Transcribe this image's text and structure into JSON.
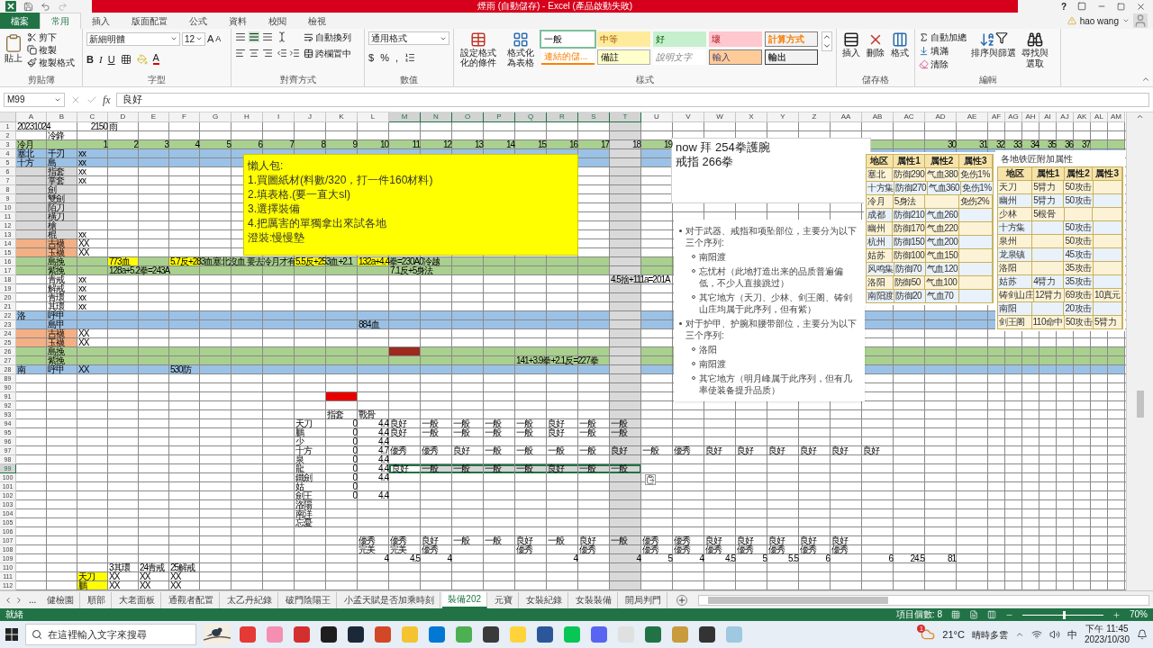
{
  "title_bar": {
    "title": "煙雨 (自動儲存) - Excel (產品啟動失敗)",
    "help": "?"
  },
  "ribbon_tabs": [
    {
      "label": "檔案",
      "kind": "file",
      "selected": false
    },
    {
      "label": "常用",
      "kind": "tab",
      "selected": true
    },
    {
      "label": "插入",
      "kind": "tab",
      "selected": false
    },
    {
      "label": "版面配置",
      "kind": "tab",
      "selected": false
    },
    {
      "label": "公式",
      "kind": "tab",
      "selected": false
    },
    {
      "label": "資料",
      "kind": "tab",
      "selected": false
    },
    {
      "label": "校閱",
      "kind": "tab",
      "selected": false
    },
    {
      "label": "檢視",
      "kind": "tab",
      "selected": false
    }
  ],
  "account": {
    "name": "hao wang"
  },
  "ribbon": {
    "clipboard": {
      "paste": "貼上",
      "cut": "剪下",
      "copy": "複製",
      "format_painter": "複製格式",
      "group": "剪貼簿"
    },
    "font": {
      "face": "新細明體",
      "size": "12",
      "grow": "A",
      "shrink": "A",
      "bold": "B",
      "italic": "I",
      "underline": "U",
      "color_letter": "A",
      "group": "字型"
    },
    "alignment": {
      "wrap": "自動換列",
      "merge": "跨欄置中",
      "group": "對齊方式"
    },
    "number": {
      "format": "通用格式",
      "currency": "$",
      "percent": "%",
      "comma": ",",
      "group": "數值"
    },
    "styles": {
      "conditional": "設定格式化的條件",
      "as_table": "格式化為表格",
      "group": "樣式",
      "gallery": [
        {
          "label": "一般",
          "kind": "normal",
          "selected": true
        },
        {
          "label": "中等",
          "kind": "neutral",
          "selected": false
        },
        {
          "label": "好",
          "kind": "good",
          "selected": false
        },
        {
          "label": "壞",
          "kind": "bad",
          "selected": false
        },
        {
          "label": "計算方式",
          "kind": "calculation",
          "selected": false
        },
        {
          "label": "連結的儲...",
          "kind": "linked",
          "selected": false
        },
        {
          "label": "備註",
          "kind": "note",
          "selected": false
        },
        {
          "label": "說明文字",
          "kind": "explanatory",
          "selected": false
        },
        {
          "label": "輸入",
          "kind": "input",
          "selected": false
        },
        {
          "label": "輸出",
          "kind": "output",
          "selected": false
        }
      ]
    },
    "cells": {
      "items": [
        {
          "label": "插入",
          "kind": "insert"
        },
        {
          "label": "刪除",
          "kind": "delete"
        },
        {
          "label": "格式",
          "kind": "format"
        }
      ],
      "group": "儲存格"
    },
    "editing": {
      "items": [
        {
          "label": "自動加總",
          "kind": "sum"
        },
        {
          "label": "填滿",
          "kind": "fill"
        },
        {
          "label": "清除",
          "kind": "clear"
        }
      ],
      "sort": "排序與篩選",
      "find": "尋找與選取",
      "group": "編輯"
    }
  },
  "formula_bar": {
    "name_box": "M99",
    "function_label": "fx",
    "value": "良好"
  },
  "columns": [
    {
      "label": "A",
      "selected": false
    },
    {
      "label": "B",
      "selected": false
    },
    {
      "label": "C",
      "selected": false
    },
    {
      "label": "D",
      "selected": false
    },
    {
      "label": "E",
      "selected": false
    },
    {
      "label": "F",
      "selected": false
    },
    {
      "label": "G",
      "selected": false
    },
    {
      "label": "H",
      "selected": false
    },
    {
      "label": "I",
      "selected": false
    },
    {
      "label": "J",
      "selected": false
    },
    {
      "label": "K",
      "selected": false
    },
    {
      "label": "L",
      "selected": false
    },
    {
      "label": "M",
      "selected": true
    },
    {
      "label": "N",
      "selected": true
    },
    {
      "label": "O",
      "selected": true
    },
    {
      "label": "P",
      "selected": true
    },
    {
      "label": "Q",
      "selected": true
    },
    {
      "label": "R",
      "selected": true
    },
    {
      "label": "S",
      "selected": true
    },
    {
      "label": "T",
      "selected": true,
      "shaded": true
    },
    {
      "label": "U",
      "selected": false
    },
    {
      "label": "V",
      "selected": false
    },
    {
      "label": "W",
      "selected": false
    },
    {
      "label": "X",
      "selected": false
    },
    {
      "label": "Y",
      "selected": false
    },
    {
      "label": "Z",
      "selected": false
    },
    {
      "label": "AA",
      "selected": false
    },
    {
      "label": "AB",
      "selected": false
    },
    {
      "label": "AC",
      "selected": false
    },
    {
      "label": "AD",
      "selected": false
    },
    {
      "label": "AE",
      "selected": false
    },
    {
      "label": "AF",
      "selected": false
    },
    {
      "label": "AG",
      "selected": false
    },
    {
      "label": "AH",
      "selected": false
    },
    {
      "label": "AI",
      "selected": false
    },
    {
      "label": "AJ",
      "selected": false
    },
    {
      "label": "AK",
      "selected": false
    },
    {
      "label": "AL",
      "selected": false
    },
    {
      "label": "AM",
      "selected": false
    }
  ],
  "rows": [
    {
      "number": "1",
      "selected": false,
      "cells": [
        {
          "text": "20231024"
        },
        {},
        {
          "text": "2150",
          "kind": "number"
        },
        {
          "text": "雨"
        }
      ]
    },
    {
      "number": "2",
      "selected": false,
      "cells": [
        {},
        {
          "text": "冷鋒"
        }
      ]
    },
    {
      "number": "3",
      "selected": false,
      "color": "#a9d08e",
      "cells": [
        {
          "text": "冷月"
        },
        {},
        {
          "text": "1",
          "kind": "number"
        },
        {
          "text": "2",
          "kind": "number"
        },
        {
          "text": "3",
          "kind": "number"
        },
        {
          "text": "4",
          "kind": "number"
        },
        {
          "text": "5",
          "kind": "number"
        },
        {
          "text": "6",
          "kind": "number"
        },
        {
          "text": "7",
          "kind": "number"
        },
        {
          "text": "8",
          "kind": "number"
        },
        {
          "text": "9",
          "kind": "number"
        },
        {
          "text": "10",
          "kind": "number"
        },
        {
          "text": "11",
          "kind": "number"
        },
        {
          "text": "12",
          "kind": "number"
        },
        {
          "text": "13",
          "kind": "number"
        },
        {
          "text": "14",
          "kind": "number"
        },
        {
          "text": "15",
          "kind": "number"
        },
        {
          "text": "16",
          "kind": "number"
        },
        {
          "text": "17",
          "kind": "number"
        },
        {
          "text": "18",
          "kind": "number"
        },
        {
          "text": "19",
          "kind": "number"
        },
        {},
        {},
        {},
        {},
        {},
        {},
        {},
        {},
        {
          "text": "30",
          "kind": "number"
        },
        {
          "text": "31",
          "kind": "number"
        },
        {
          "text": "32",
          "kind": "number"
        },
        {
          "text": "33",
          "kind": "number"
        },
        {
          "text": "34",
          "kind": "number"
        },
        {
          "text": "35",
          "kind": "number"
        },
        {
          "text": "36",
          "kind": "number"
        },
        {
          "text": "37",
          "kind": "number"
        }
      ]
    },
    {
      "number": "4",
      "selected": false,
      "color": "#9bc2e6",
      "cells": [
        {
          "text": "塞北"
        },
        {
          "text": "千刃"
        },
        {
          "text": "xx"
        }
      ]
    },
    {
      "number": "5",
      "selected": false,
      "color": "#9bc2e6",
      "cells": [
        {
          "text": "十方"
        },
        {
          "text": "島"
        },
        {
          "text": "xx"
        }
      ]
    },
    {
      "number": "6",
      "selected": false,
      "cells": [
        {
          "color": "#d9d9d9"
        },
        {
          "text": "指套",
          "color": "#d9d9d9"
        },
        {
          "text": "xx"
        }
      ]
    },
    {
      "number": "7",
      "selected": false,
      "cells": [
        {
          "color": "#d9d9d9"
        },
        {
          "text": "掌套",
          "color": "#d9d9d9"
        },
        {
          "text": "xx"
        }
      ]
    },
    {
      "number": "8",
      "selected": false,
      "cells": [
        {
          "color": "#d9d9d9"
        },
        {
          "text": "劍",
          "color": "#d9d9d9"
        }
      ]
    },
    {
      "number": "9",
      "selected": false,
      "cells": [
        {
          "color": "#d9d9d9"
        },
        {
          "text": "雙劍",
          "color": "#d9d9d9"
        }
      ]
    },
    {
      "number": "10",
      "selected": false,
      "cells": [
        {
          "color": "#d9d9d9"
        },
        {
          "text": "陌刀",
          "color": "#d9d9d9"
        }
      ]
    },
    {
      "number": "11",
      "selected": false,
      "cells": [
        {
          "color": "#d9d9d9"
        },
        {
          "text": "橫刀",
          "color": "#d9d9d9"
        }
      ]
    },
    {
      "number": "12",
      "selected": false,
      "cells": [
        {
          "color": "#d9d9d9"
        },
        {
          "text": "槍",
          "color": "#d9d9d9"
        }
      ]
    },
    {
      "number": "13",
      "selected": false,
      "cells": [
        {
          "color": "#d9d9d9"
        },
        {
          "text": "棍",
          "color": "#d9d9d9"
        },
        {
          "text": "xx"
        }
      ]
    },
    {
      "number": "14",
      "selected": false,
      "cells": [
        {
          "color": "#f4b084"
        },
        {
          "text": "吉襪",
          "color": "#f4b084"
        },
        {
          "text": "XX"
        }
      ]
    },
    {
      "number": "15",
      "selected": false,
      "cells": [
        {
          "color": "#f4b084"
        },
        {
          "text": "玉襪",
          "color": "#f4b084"
        },
        {
          "text": "XX"
        }
      ]
    },
    {
      "number": "16",
      "selected": false,
      "color": "#a9d08e",
      "cells": [
        {},
        {
          "text": "島挽"
        },
        {},
        {
          "text": "773血",
          "color": "#ffff00"
        },
        {},
        {
          "text": "5.7反+283血塞北沒血 要去冷月才有",
          "color": "#ffff00"
        },
        {},
        {},
        {},
        {
          "text": "5.5反+253血+2.1",
          "color": "#ffff00"
        },
        {},
        {
          "text": "132a+4.4拳=230A0冷越",
          "color": "#ffff00"
        }
      ]
    },
    {
      "number": "17",
      "selected": false,
      "color": "#a9d08e",
      "cells": [
        {},
        {
          "text": "紫挽"
        },
        {},
        {
          "text": "128a+5.2拳=243A"
        },
        {},
        {},
        {},
        {},
        {},
        {},
        {},
        {},
        {
          "text": "7.1反+5身法"
        }
      ]
    },
    {
      "number": "18",
      "selected": false,
      "cells": [
        {},
        {
          "text": "青戒"
        },
        {
          "text": "xx"
        },
        {},
        {},
        {},
        {},
        {},
        {},
        {},
        {},
        {},
        {},
        {},
        {},
        {},
        {},
        {},
        {},
        {
          "text": "4.5捨+111a=201A"
        }
      ]
    },
    {
      "number": "19",
      "selected": false,
      "cells": [
        {},
        {
          "text": "解戒"
        },
        {
          "text": "xx"
        }
      ]
    },
    {
      "number": "20",
      "selected": false,
      "cells": [
        {},
        {
          "text": "青環"
        },
        {
          "text": "xx"
        }
      ]
    },
    {
      "number": "21",
      "selected": false,
      "cells": [
        {},
        {
          "text": "其環"
        },
        {
          "text": "xx"
        }
      ]
    },
    {
      "number": "22",
      "selected": false,
      "color": "#9bc2e6",
      "cells": [
        {
          "text": "洛"
        },
        {
          "text": "呼甲"
        }
      ]
    },
    {
      "number": "23",
      "selected": false,
      "color": "#9bc2e6",
      "cells": [
        {},
        {
          "text": "島甲"
        },
        {},
        {},
        {},
        {},
        {},
        {},
        {},
        {},
        {},
        {
          "text": "884血"
        }
      ]
    },
    {
      "number": "24",
      "selected": false,
      "cells": [
        {
          "color": "#f4b084"
        },
        {
          "text": "吉襪",
          "color": "#f4b084"
        },
        {
          "text": "XX"
        }
      ]
    },
    {
      "number": "25",
      "selected": false,
      "cells": [
        {
          "color": "#f4b084"
        },
        {
          "text": "玉襪",
          "color": "#f4b084"
        },
        {
          "text": "XX"
        }
      ]
    },
    {
      "number": "26",
      "selected": false,
      "color": "#a9d08e",
      "cells": [
        {},
        {
          "text": "島挽"
        },
        {},
        {},
        {},
        {},
        {},
        {},
        {},
        {},
        {},
        {},
        {
          "color": "#9c2a1f"
        }
      ]
    },
    {
      "number": "27",
      "selected": false,
      "color": "#a9d08e",
      "cells": [
        {},
        {
          "text": "紫挽"
        },
        {},
        {},
        {},
        {},
        {},
        {},
        {},
        {},
        {},
        {},
        {},
        {},
        {},
        {},
        {
          "text": "141+3.9拳+2.1反=227拳"
        }
      ]
    },
    {
      "number": "28",
      "selected": false,
      "color": "#9bc2e6",
      "cells": [
        {
          "text": "南"
        },
        {
          "text": "呼甲"
        },
        {
          "text": "XX"
        },
        {},
        {},
        {
          "text": "530防"
        }
      ]
    },
    {
      "number": "89",
      "selected": false
    },
    {
      "number": "90",
      "selected": false
    },
    {
      "number": "91",
      "selected": false,
      "cells": [
        {},
        {},
        {},
        {},
        {},
        {},
        {},
        {},
        {},
        {},
        {
          "color": "#e60000"
        }
      ]
    },
    {
      "number": "92",
      "selected": false
    },
    {
      "number": "93",
      "selected": false,
      "cells": [
        {},
        {},
        {},
        {},
        {},
        {},
        {},
        {},
        {},
        {},
        {
          "text": "指套"
        },
        {
          "text": "戰骨"
        }
      ]
    },
    {
      "number": "94",
      "selected": false,
      "cells": [
        {},
        {},
        {},
        {},
        {},
        {},
        {},
        {},
        {},
        {
          "text": "天刀"
        },
        {
          "text": "0",
          "kind": "number"
        },
        {
          "text": "4.4",
          "kind": "number"
        },
        {
          "text": "良好"
        },
        {
          "text": "一般"
        },
        {
          "text": "一般"
        },
        {
          "text": "一般"
        },
        {
          "text": "一般"
        },
        {
          "text": "良好"
        },
        {
          "text": "一般"
        },
        {
          "text": "一般"
        }
      ]
    },
    {
      "number": "95",
      "selected": false,
      "cells": [
        {},
        {},
        {},
        {},
        {},
        {},
        {},
        {},
        {},
        {
          "text": "鵬"
        },
        {
          "text": "0",
          "kind": "number"
        },
        {
          "text": "4.4",
          "kind": "number"
        },
        {
          "text": "良好"
        },
        {
          "text": "一般"
        },
        {
          "text": "一般"
        },
        {
          "text": "一般"
        },
        {
          "text": "一般"
        },
        {
          "text": "良好"
        },
        {
          "text": "一般"
        },
        {
          "text": "一般"
        }
      ]
    },
    {
      "number": "96",
      "selected": false,
      "cells": [
        {},
        {},
        {},
        {},
        {},
        {},
        {},
        {},
        {},
        {
          "text": "少"
        },
        {
          "text": "0",
          "kind": "number"
        },
        {
          "text": "4.4",
          "kind": "number"
        }
      ]
    },
    {
      "number": "97",
      "selected": false,
      "cells": [
        {},
        {},
        {},
        {},
        {},
        {},
        {},
        {},
        {},
        {
          "text": "十方"
        },
        {
          "text": "0",
          "kind": "number"
        },
        {
          "text": "4.7",
          "kind": "number"
        },
        {
          "text": "優秀"
        },
        {
          "text": "優秀"
        },
        {
          "text": "良好"
        },
        {
          "text": "一般"
        },
        {
          "text": "一般"
        },
        {
          "text": "一般"
        },
        {
          "text": "一般"
        },
        {
          "text": "良好"
        },
        {
          "text": "一般"
        },
        {
          "text": "優秀"
        },
        {
          "text": "良好"
        },
        {
          "text": "良好"
        },
        {
          "text": "良好"
        },
        {
          "text": "良好"
        },
        {
          "text": "良好"
        },
        {
          "text": "良好"
        }
      ]
    },
    {
      "number": "98",
      "selected": false,
      "cells": [
        {},
        {},
        {},
        {},
        {},
        {},
        {},
        {},
        {},
        {
          "text": "泉"
        },
        {
          "text": "0",
          "kind": "number"
        },
        {
          "text": "4.4",
          "kind": "number"
        }
      ]
    },
    {
      "number": "99",
      "selected": true,
      "cells": [
        {},
        {},
        {},
        {},
        {},
        {},
        {},
        {},
        {},
        {
          "text": "龍",
          "selected": false
        },
        {
          "text": "0",
          "kind": "number",
          "selected": false
        },
        {
          "text": "4.4",
          "kind": "number",
          "selected": false
        },
        {
          "text": "良好",
          "selected": true
        },
        {
          "text": "一般",
          "selected": true
        },
        {
          "text": "一般",
          "selected": true
        },
        {
          "text": "一般",
          "selected": true
        },
        {
          "text": "一般",
          "selected": true
        },
        {
          "text": "良好",
          "selected": true
        },
        {
          "text": "一般",
          "selected": true
        },
        {
          "text": "一般",
          "selected": true
        }
      ]
    },
    {
      "number": "100",
      "selected": false,
      "cells": [
        {},
        {},
        {},
        {},
        {},
        {},
        {},
        {},
        {},
        {
          "text": "鐵劍"
        },
        {
          "text": "0",
          "kind": "number"
        },
        {
          "text": "4.4",
          "kind": "number"
        }
      ]
    },
    {
      "number": "101",
      "selected": false,
      "cells": [
        {},
        {},
        {},
        {},
        {},
        {},
        {},
        {},
        {},
        {
          "text": "姑"
        },
        {
          "text": "0",
          "kind": "number"
        }
      ]
    },
    {
      "number": "102",
      "selected": false,
      "cells": [
        {},
        {},
        {},
        {},
        {},
        {},
        {},
        {},
        {},
        {
          "text": "劍王"
        },
        {
          "text": "0",
          "kind": "number"
        },
        {
          "text": "4.4",
          "kind": "number"
        }
      ]
    },
    {
      "number": "103",
      "selected": false,
      "cells": [
        {},
        {},
        {},
        {},
        {},
        {},
        {},
        {},
        {},
        {
          "text": "洛陽"
        }
      ]
    },
    {
      "number": "104",
      "selected": false,
      "cells": [
        {},
        {},
        {},
        {},
        {},
        {},
        {},
        {},
        {},
        {
          "text": "南洋"
        }
      ]
    },
    {
      "number": "105",
      "selected": false,
      "cells": [
        {},
        {},
        {},
        {},
        {},
        {},
        {},
        {},
        {},
        {
          "text": "忘憂"
        }
      ]
    },
    {
      "number": "106",
      "selected": false
    },
    {
      "number": "107",
      "selected": false,
      "cells": [
        {},
        {},
        {},
        {},
        {},
        {},
        {},
        {},
        {},
        {},
        {},
        {
          "text": "優秀"
        },
        {
          "text": "優秀"
        },
        {
          "text": "良好"
        },
        {
          "text": "一般"
        },
        {
          "text": "一般"
        },
        {
          "text": "良好"
        },
        {
          "text": "一般"
        },
        {
          "text": "良好"
        },
        {
          "text": "一般"
        },
        {
          "text": "優秀"
        },
        {
          "text": "優秀"
        },
        {
          "text": "良好"
        },
        {
          "text": "良好"
        },
        {
          "text": "良好"
        },
        {
          "text": "良好"
        },
        {
          "text": "良好"
        }
      ]
    },
    {
      "number": "108",
      "selected": false,
      "cells": [
        {},
        {},
        {},
        {},
        {},
        {},
        {},
        {},
        {},
        {},
        {},
        {
          "text": "完美"
        },
        {
          "text": "完美"
        },
        {
          "text": "優秀"
        },
        {},
        {},
        {
          "text": "優秀"
        },
        {},
        {
          "text": "優秀"
        },
        {},
        {
          "text": "優秀"
        },
        {
          "text": "優秀"
        },
        {
          "text": "優秀"
        },
        {
          "text": "優秀"
        },
        {
          "text": "優秀"
        },
        {
          "text": "優秀"
        },
        {
          "text": "優秀"
        }
      ]
    },
    {
      "number": "109",
      "selected": false,
      "cells": [
        {},
        {},
        {},
        {},
        {},
        {},
        {},
        {},
        {},
        {},
        {},
        {
          "text": "4",
          "kind": "number"
        },
        {
          "text": "4.5",
          "kind": "number"
        },
        {
          "text": "4",
          "kind": "number"
        },
        {},
        {},
        {},
        {
          "text": "4",
          "kind": "number"
        },
        {},
        {
          "text": "4",
          "kind": "number"
        },
        {
          "text": "5",
          "kind": "number"
        },
        {
          "text": "4",
          "kind": "number"
        },
        {
          "text": "4.5",
          "kind": "number"
        },
        {
          "text": "5",
          "kind": "number"
        },
        {
          "text": "5.5",
          "kind": "number"
        },
        {
          "text": "6",
          "kind": "number"
        },
        {},
        {
          "text": "6",
          "kind": "number"
        },
        {
          "text": "24.5",
          "kind": "number"
        },
        {
          "text": "81",
          "kind": "number"
        }
      ]
    },
    {
      "number": "110",
      "selected": false,
      "cells": [
        {},
        {},
        {},
        {
          "text": "3其環"
        },
        {
          "text": "24青戒"
        },
        {
          "text": "25解戒"
        }
      ]
    },
    {
      "number": "111",
      "selected": false,
      "cells": [
        {},
        {},
        {
          "text": "天刀",
          "color": "#ffff00"
        },
        {
          "text": "XX"
        },
        {
          "text": "XX"
        },
        {
          "text": "XX"
        }
      ]
    },
    {
      "number": "112",
      "selected": false,
      "cells": [
        {},
        {},
        {
          "text": "鵬",
          "color": "#ffff00"
        },
        {
          "text": "XX"
        },
        {
          "text": "XX"
        },
        {
          "text": "XX"
        }
      ]
    }
  ],
  "note": {
    "lines": [
      "懶人包:",
      "1.買圖紙材(料數/320，打一件160材料)",
      "2.填表格.(要一直大sl)",
      "3.選擇裝備",
      "4.把厲害的單獨拿出來試各地",
      "澄裝:慢慢墊"
    ]
  },
  "memo": {
    "lines": [
      "now 拜 254拳護腕",
      "戒指 266拳"
    ]
  },
  "guide": {
    "items": [
      {
        "text": "对于武器、戒指和项坠部位，主要分为以下三个序列:",
        "children": [
          {
            "text": "南阳渡"
          },
          {
            "text": "忘忧村（此地打造出来的品质普遍偏低，不少人直接跳过）"
          },
          {
            "text": "其它地方（天刀、少林、剑王阁、铸剑山庄均属于此序列，但有紫）"
          }
        ]
      },
      {
        "text": "对于护甲、护腕和腰带部位，主要分为以下三个序列:",
        "children": [
          {
            "text": "洛阳"
          },
          {
            "text": "南阳渡"
          },
          {
            "text": "其它地方（明月峰属于此序列，但有几率使装备提升品质）"
          }
        ]
      }
    ]
  },
  "region_table": {
    "columns": [
      "地区",
      "属性1",
      "属性2",
      "属性3"
    ],
    "rows": [
      [
        "塞北",
        "防御290",
        "气血380",
        "免伤1%"
      ],
      [
        "十方集",
        "防御270",
        "气血360",
        "免伤1%"
      ],
      [
        "冷月",
        "5身法",
        "",
        "免伤2%"
      ],
      [
        "成都",
        "防御210",
        "气血260",
        ""
      ],
      [
        "幽州",
        "防御170",
        "气血220",
        ""
      ],
      [
        "杭州",
        "防御150",
        "气血200",
        ""
      ],
      [
        "姑苏",
        "防御100",
        "气血150",
        ""
      ],
      [
        "风鸣集",
        "防御70",
        "气血120",
        ""
      ],
      [
        "洛阳",
        "防御50",
        "气血100",
        ""
      ],
      [
        "南阳渡",
        "防御20",
        "气血70",
        ""
      ]
    ]
  },
  "smith_table": {
    "title": "各地铁匠附加属性",
    "columns": [
      "地区",
      "属性1",
      "属性2",
      "属性3"
    ],
    "rows": [
      [
        "天刀",
        "5臂力",
        "50攻击",
        ""
      ],
      [
        "幽州",
        "5臂力",
        "50攻击",
        ""
      ],
      [
        "少林",
        "5根骨",
        "",
        ""
      ],
      [
        "十方集",
        "",
        "50攻击",
        ""
      ],
      [
        "泉州",
        "",
        "50攻击",
        ""
      ],
      [
        "龙泉镇",
        "",
        "45攻击",
        ""
      ],
      [
        "洛阳",
        "",
        "35攻击",
        ""
      ],
      [
        "姑苏",
        "4臂力",
        "35攻击",
        ""
      ],
      [
        "铸剑山庄",
        "12臂力",
        "69攻击",
        "10真元"
      ],
      [
        "南阳",
        "",
        "20攻击",
        ""
      ],
      [
        "剑王阁",
        "110命中",
        "50攻击",
        "5臂力"
      ]
    ]
  },
  "sheet_tabs": {
    "more": "...",
    "tabs": [
      {
        "label": "健檢園",
        "selected": false
      },
      {
        "label": "順部",
        "selected": false
      },
      {
        "label": "大老面板",
        "selected": false
      },
      {
        "label": "通觀者配置",
        "selected": false
      },
      {
        "label": "太乙丹紀錄",
        "selected": false
      },
      {
        "label": "破門陰陽王",
        "selected": false
      },
      {
        "label": "小孟天賦是否加乘時刻",
        "selected": false
      },
      {
        "label": "裝備202",
        "selected": true
      },
      {
        "label": "元寶",
        "selected": false
      },
      {
        "label": "女裝紀錄",
        "selected": false
      },
      {
        "label": "女裝裝備",
        "selected": false
      },
      {
        "label": "開局判門",
        "selected": false
      }
    ]
  },
  "status_bar": {
    "state": "就緒",
    "count": "項目個數: 8",
    "zoom": "70%",
    "level": 0.5
  },
  "taskbar": {
    "search_placeholder": "在這裡輸入文字來搜尋",
    "badge": "1",
    "temperature": "21°C",
    "weather": "晴時多雲",
    "ime": "中",
    "time": "下午 11:45",
    "date": "2023/10/30"
  }
}
